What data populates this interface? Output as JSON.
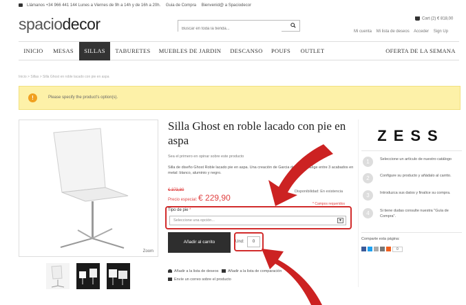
{
  "topbar": {
    "phone": "Llámanos +34 966 441 144 Lunes a Viernes de 9h a 14h y de 16h a 20h.",
    "guide": "Guia de Compra",
    "welcome": "Bienvenid@ a Spaciodecor"
  },
  "logo": {
    "part1": "spacio",
    "part2": "decor"
  },
  "search": {
    "placeholder": "Buscar en toda la tienda..."
  },
  "cart": {
    "label": "Cart (2) € 818,00"
  },
  "account_links": [
    "Mi cuenta",
    "Mi lista de deseos",
    "Acceder",
    "Sign Up"
  ],
  "nav": {
    "items": [
      "INICIO",
      "MESAS",
      "SILLAS",
      "TABURETES",
      "MUEBLES DE JARDIN",
      "DESCANSO",
      "POUFS",
      "OUTLET",
      "OFERTA DE LA SEMANA"
    ],
    "active": "SILLAS"
  },
  "breadcrumb": "Inicio > Sillas > Silla Ghost en roble lacado con pie en aspa",
  "alert": {
    "icon": "!",
    "text": "Please specify the product's option(s)."
  },
  "product": {
    "title": "Silla Ghost en roble lacado con pie en aspa",
    "review_link": "Sea el primero en opinar sobre este producto",
    "description": "Silla de diseño Ghost Roble lacado pie en aspa. Una creación de Garcia de Vicuña. Elige entre 3 acabados en metal: blanco, aluminio y negro.",
    "old_price": "€ 373,80",
    "special_label": "Precio especial:",
    "special_price": "€ 229,90",
    "availability": "Disponibilidad: En existencia",
    "required_note": "* Campos requeridos",
    "option_label": "Tipo de pie",
    "option_required": "*",
    "option_placeholder": "Seleccione una opción...",
    "add_to_cart": "Añadir al carrito",
    "qty_label": "Und:",
    "qty_value": "0",
    "zoom": "Zoom",
    "wishlist": "Añadir a la lista de deseos",
    "compare": "Añadir a la lista de comparación",
    "email": "Envíe un correo sobre el producto"
  },
  "sidebar": {
    "brand": "ZESS",
    "steps": [
      {
        "num": "1",
        "text": "Seleccione un artículo de nuestro catálogo"
      },
      {
        "num": "2",
        "text": "Configure su producto y añádalo al carrito."
      },
      {
        "num": "3",
        "text": "Introduzca sus datos y finalice su compra."
      },
      {
        "num": "4",
        "text": "Si tiene dudas consulte nuestra \"Guía de Compra\"."
      }
    ],
    "share_label": "Comparte esta página:",
    "share_count": "0"
  },
  "colors": {
    "accent_red": "#d12a2a",
    "nav_active": "#333333",
    "alert_bg": "#fdf1a8",
    "price_red": "#e04040"
  }
}
